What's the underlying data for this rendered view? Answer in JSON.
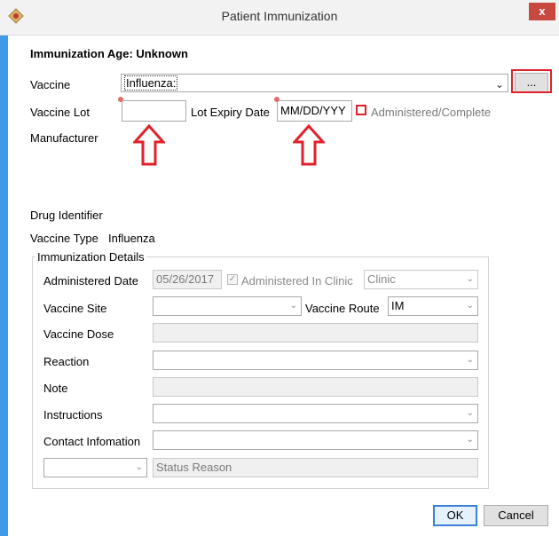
{
  "window": {
    "title": "Patient Immunization",
    "close_label": "x"
  },
  "header": {
    "age_label": "Immunization Age: Unknown"
  },
  "vaccine": {
    "label": "Vaccine",
    "value": "Influenza:",
    "browse_label": "..."
  },
  "vaccine_lot": {
    "label": "Vaccine Lot",
    "value": ""
  },
  "lot_expiry": {
    "label": "Lot Expiry Date",
    "value": "MM/DD/YYY"
  },
  "administered_complete": {
    "label": "Administered/Complete",
    "checked": false
  },
  "manufacturer": {
    "label": "Manufacturer"
  },
  "drug_identifier": {
    "label": "Drug Identifier"
  },
  "vaccine_type": {
    "label": "Vaccine Type",
    "value": "Influenza"
  },
  "details": {
    "legend": "Immunization Details",
    "administered_date": {
      "label": "Administered Date",
      "value": "05/26/2017"
    },
    "administered_in_clinic": {
      "label": "Administered In Clinic",
      "checked": true
    },
    "clinic": {
      "value": "Clinic"
    },
    "vaccine_site": {
      "label": "Vaccine Site",
      "value": ""
    },
    "vaccine_route": {
      "label": "Vaccine Route",
      "value": "IM"
    },
    "vaccine_dose": {
      "label": "Vaccine Dose",
      "value": ""
    },
    "reaction": {
      "label": "Reaction",
      "value": ""
    },
    "note": {
      "label": "Note",
      "value": ""
    },
    "instructions": {
      "label": "Instructions",
      "value": ""
    },
    "contact": {
      "label": "Contact Infomation",
      "value": ""
    },
    "status": {
      "value": ""
    },
    "status_reason": {
      "placeholder": "Status Reason"
    }
  },
  "buttons": {
    "ok": "OK",
    "cancel": "Cancel"
  },
  "colors": {
    "accent": "#3f9ae8",
    "annotation_red": "#e0202a",
    "close_red": "#c7483f"
  }
}
